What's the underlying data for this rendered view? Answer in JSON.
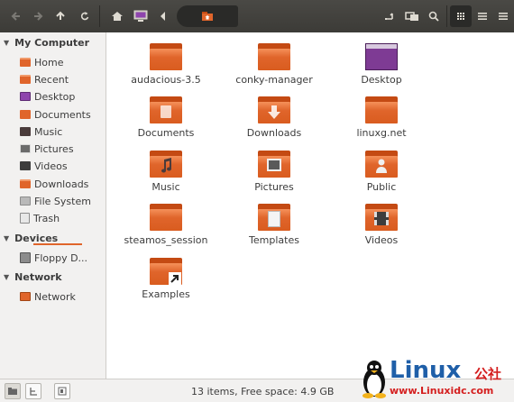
{
  "toolbar": {
    "back": "◀",
    "forward": "▶",
    "up": "▲",
    "reload": "↻",
    "home": "⌂",
    "prev_path": "◀"
  },
  "sidebar": {
    "sections": [
      {
        "label": "My Computer"
      },
      {
        "label": "Devices"
      },
      {
        "label": "Network"
      }
    ],
    "my_computer": [
      {
        "label": "Home",
        "icon": "home-folder-icon"
      },
      {
        "label": "Recent",
        "icon": "recent-folder-icon"
      },
      {
        "label": "Desktop",
        "icon": "desktop-icon"
      },
      {
        "label": "Documents",
        "icon": "documents-icon"
      },
      {
        "label": "Music",
        "icon": "music-icon"
      },
      {
        "label": "Pictures",
        "icon": "pictures-icon"
      },
      {
        "label": "Videos",
        "icon": "videos-icon"
      },
      {
        "label": "Downloads",
        "icon": "downloads-icon"
      },
      {
        "label": "File System",
        "icon": "filesystem-icon"
      },
      {
        "label": "Trash",
        "icon": "trash-icon"
      }
    ],
    "devices": [
      {
        "label": "Floppy D...",
        "icon": "floppy-icon"
      }
    ],
    "network": [
      {
        "label": "Network",
        "icon": "network-icon"
      }
    ]
  },
  "files": [
    {
      "name": "audacious-3.5",
      "icon": "folder-icon"
    },
    {
      "name": "conky-manager",
      "icon": "folder-icon"
    },
    {
      "name": "Desktop",
      "icon": "desktop-folder-icon"
    },
    {
      "name": "Documents",
      "icon": "documents-folder-icon"
    },
    {
      "name": "Downloads",
      "icon": "downloads-folder-icon"
    },
    {
      "name": "linuxg.net",
      "icon": "folder-icon"
    },
    {
      "name": "Music",
      "icon": "music-folder-icon"
    },
    {
      "name": "Pictures",
      "icon": "pictures-folder-icon"
    },
    {
      "name": "Public",
      "icon": "public-folder-icon"
    },
    {
      "name": "steamos_session",
      "icon": "folder-icon"
    },
    {
      "name": "Templates",
      "icon": "templates-folder-icon"
    },
    {
      "name": "Videos",
      "icon": "videos-folder-icon"
    },
    {
      "name": "Examples",
      "icon": "examples-folder-icon"
    }
  ],
  "status": {
    "text": "13 items, Free space: 4.9 GB"
  },
  "watermark": {
    "brand": "Linux",
    "brand_cn": "公社",
    "url": "www.Linuxidc.com"
  },
  "colors": {
    "accent": "#e0652b",
    "toolbar": "#3c3b37",
    "sidebar": "#f2f1f0"
  }
}
